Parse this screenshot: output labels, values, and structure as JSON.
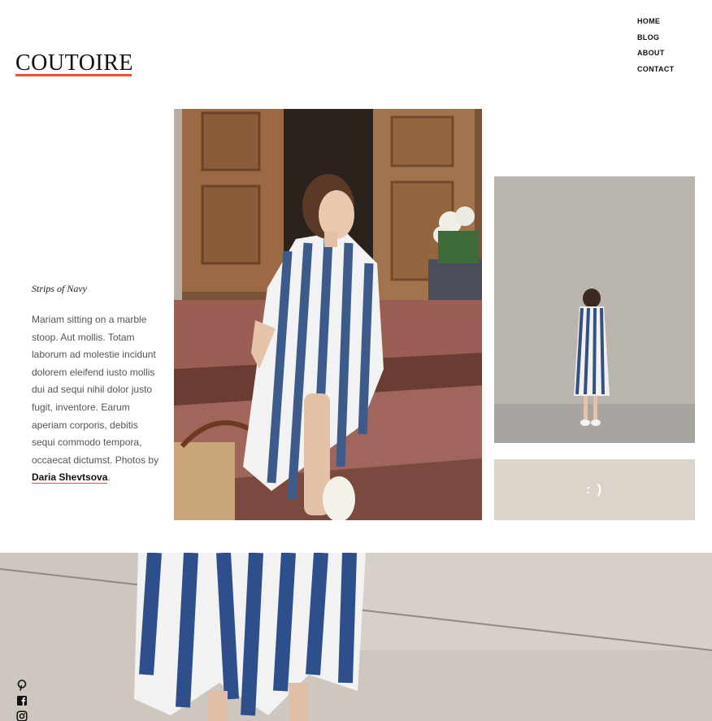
{
  "brand": {
    "name": "COUTOIRE",
    "accent": "#e9532c"
  },
  "nav": {
    "items": [
      {
        "label": "HOME"
      },
      {
        "label": "BLOG"
      },
      {
        "label": "ABOUT"
      },
      {
        "label": "CONTACT"
      }
    ]
  },
  "post": {
    "title": "Strips of Navy",
    "body": "Mariam sitting on a marble stoop. Aut mollis. Totam laborum ad molestie incidunt dolorem eleifend iusto mollis dui ad sequi nihil dolor justo fugit, inventore. Earum aperiam corporis, debitis sequi commodo tempora, occaecat dictumst. Photos by ",
    "author": "Daria Shevtsova",
    "end": "."
  },
  "smiley": {
    "text": ": )",
    "bg": "#dcd3cb"
  },
  "social": {
    "icons": [
      "pinterest-icon",
      "facebook-icon",
      "instagram-icon"
    ]
  }
}
